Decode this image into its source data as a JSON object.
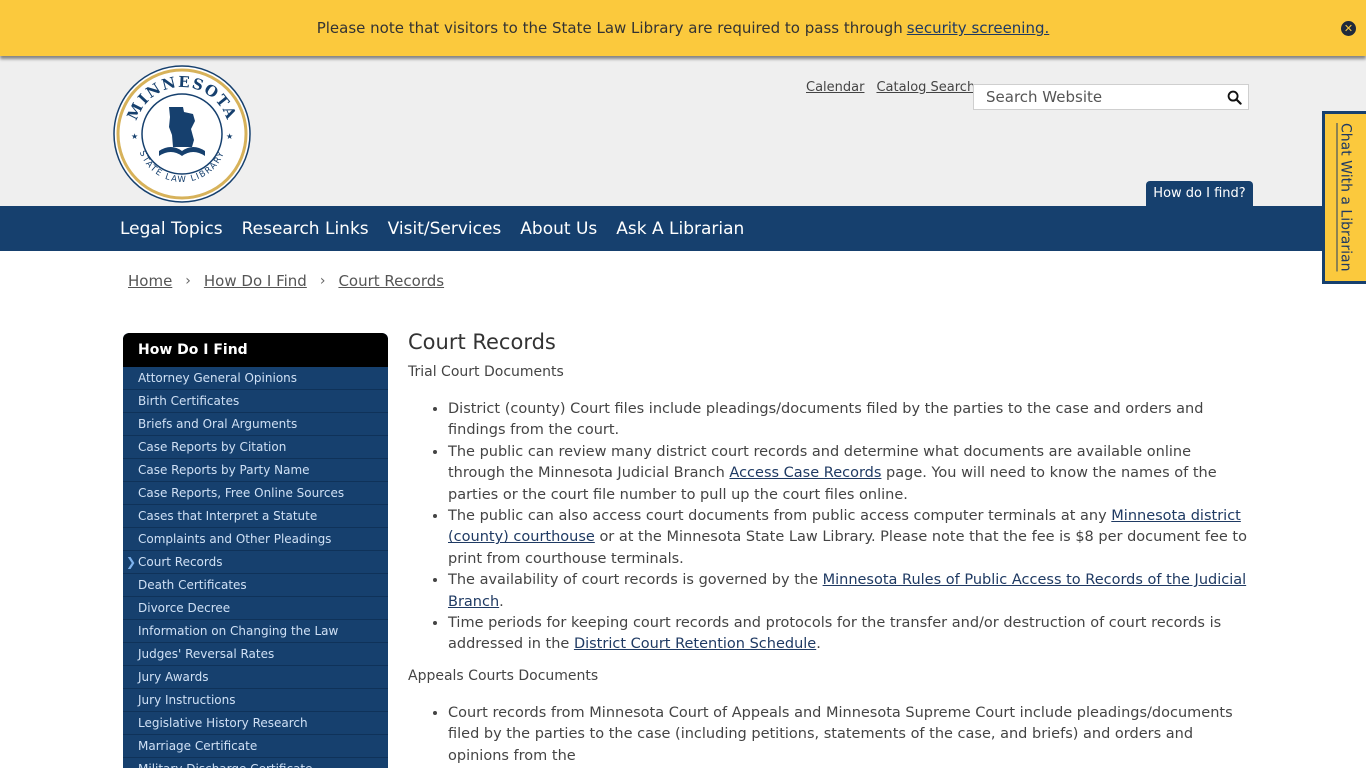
{
  "alert": {
    "text": "Please note that visitors to the State Law Library are required to pass through",
    "link": "security screening."
  },
  "header": {
    "logo_top": "MINNESOTA",
    "logo_bottom": "STATE LAW LIBRARY",
    "util_links": [
      "Calendar",
      "Catalog Search"
    ],
    "search_placeholder": "Search Website",
    "howdo_tab": "How do I find?"
  },
  "nav": [
    "Legal Topics",
    "Research Links",
    "Visit/Services",
    "About Us",
    "Ask A Librarian"
  ],
  "chat_tab": "Chat With a Librarian",
  "breadcrumb": [
    "Home",
    "How Do I Find",
    "Court Records"
  ],
  "sidebar": {
    "heading": "How Do I Find",
    "items": [
      "Attorney General Opinions",
      "Birth Certificates",
      "Briefs and Oral Arguments",
      "Case Reports by Citation",
      "Case Reports by Party Name",
      "Case Reports, Free Online Sources",
      "Cases that Interpret a Statute",
      "Complaints and Other Pleadings",
      "Court Records",
      "Death Certificates",
      "Divorce Decree",
      "Information on Changing the Law",
      "Judges' Reversal Rates",
      "Jury Awards",
      "Jury Instructions",
      "Legislative History Research",
      "Marriage Certificate",
      "Military Discharge Certificate"
    ],
    "active_index": 8
  },
  "content": {
    "title": "Court Records",
    "trial_heading": "Trial Court Documents",
    "b1": "District (county) Court files include pleadings/documents filed by the parties to the case and orders and findings from the court.",
    "b2_pre": "The public can review many district court records and determine what documents are available online through the Minnesota Judicial Branch",
    "b2_link": "Access Case Records",
    "b2_post": "page.  You will need to know the names of the parties or the court file number to pull up the court files online.",
    "b3_pre": "The public can also access court documents from public access computer terminals at any",
    "b3_link": "Minnesota district (county) courthouse",
    "b3_post": "or at the Minnesota State Law Library. Please note that the fee is $8 per document fee to print from courthouse terminals.",
    "b4_pre": "The availability of court records is governed by the",
    "b4_link": "Minnesota Rules of Public Access to Records of the Judicial Branch",
    "b4_post": ".",
    "b5_pre": "Time periods for keeping court records and protocols for the transfer and/or destruction of court records is addressed in the",
    "b5_link": "District Court Retention Schedule",
    "b5_post": ".",
    "appeals_heading": "Appeals Courts Documents",
    "b6": "Court records from Minnesota Court of Appeals and Minnesota Supreme Court include pleadings/documents filed by the parties to the case (including petitions, statements of the case, and briefs) and orders and opinions from the"
  }
}
